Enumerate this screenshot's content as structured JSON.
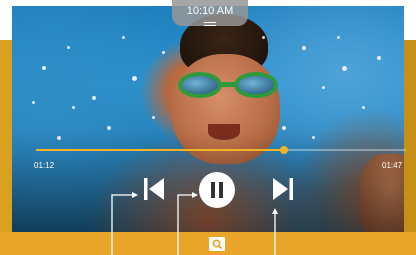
{
  "status_bar": {
    "time": "10:10 AM"
  },
  "player": {
    "elapsed": "01:12",
    "total": "01:47",
    "progress_fraction": 0.67,
    "accent_color": "#f2b324",
    "controls": [
      {
        "icon": "skip-previous-icon"
      },
      {
        "icon": "pause-icon"
      },
      {
        "icon": "skip-next-icon"
      }
    ]
  },
  "bottom_bar": {
    "icon": "image-search-icon",
    "color": "#e9a52a"
  }
}
